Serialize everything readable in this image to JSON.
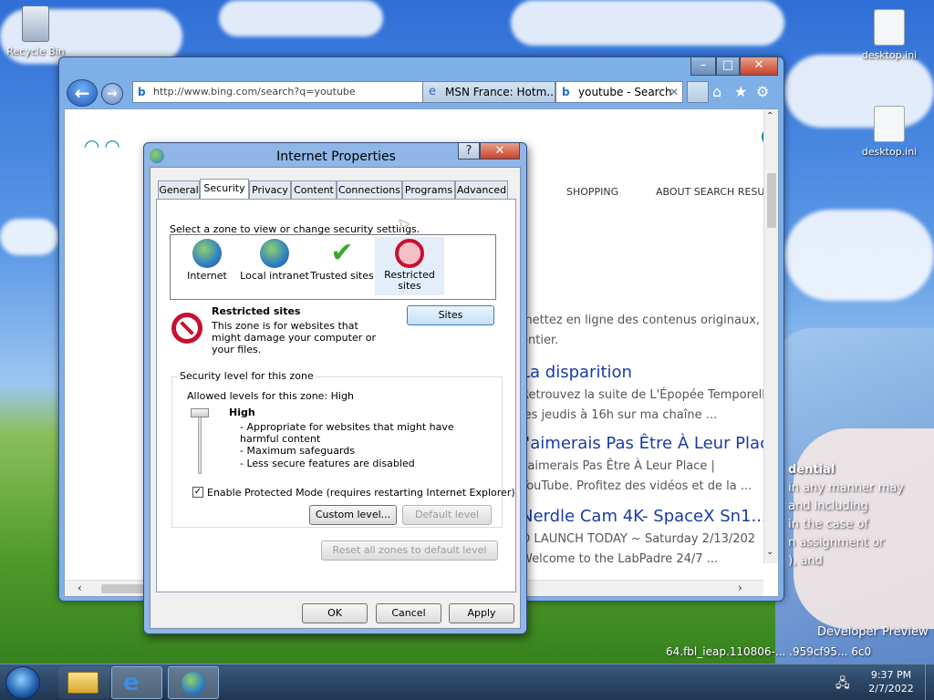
{
  "desktop": {
    "icons": [
      {
        "label": "Recycle Bin"
      },
      {
        "label": "desktop.ini"
      },
      {
        "label": "desktop.ini"
      }
    ],
    "watermark": {
      "line1": "dential",
      "line2": "in any manner may",
      "line3": "and including",
      "line4": "in the case of",
      "line5": "n assignment or",
      "line6": "), and",
      "line7": "Developer Preview",
      "line8": "64.fbl_ieap.110806-... .959cf95... 6c0"
    }
  },
  "ie": {
    "address": "http://www.bing.com/search?q=youtube",
    "tabs": [
      {
        "label": "MSN France: Hotm..."
      },
      {
        "label": "youtube - Search"
      }
    ],
    "nav_items": [
      {
        "label": "SHOPPING"
      },
      {
        "label": "ABOUT SEARCH RESU"
      }
    ],
    "results": [
      {
        "text": "mettez en ligne des contenus originaux,"
      },
      {
        "text": "entier."
      },
      {
        "title": "La disparition",
        "line1": "Retrouvez la suite de L'Épopée Temporelle",
        "line2": "les jeudis à 16h sur ma chaîne ..."
      },
      {
        "title": "J'aimerais Pas Être À Leur Place",
        "line1": "J'aimerais Pas Être À Leur Place |",
        "line2": "YouTube. Profitez des vidéos et de la ..."
      },
      {
        "title": "Nerdle Cam 4K- SpaceX Sn1...",
        "line1": "O LAUNCH TODAY ~ Saturday 2/13/202",
        "line2": "Welcome to the LabPadre 24/7 ..."
      }
    ]
  },
  "dialog": {
    "title": "Internet Properties",
    "tabs": [
      "General",
      "Security",
      "Privacy",
      "Content",
      "Connections",
      "Programs",
      "Advanced"
    ],
    "zone_prompt": "Select a zone to view or change security settings.",
    "zones": [
      {
        "label": "Internet",
        "icon": "globe-icon"
      },
      {
        "label": "Local intranet",
        "icon": "intranet-icon"
      },
      {
        "label": "Trusted sites",
        "icon": "checkmark-icon"
      },
      {
        "label": "Restricted sites",
        "icon": "restricted-icon"
      }
    ],
    "zone_heading": "Restricted sites",
    "zone_desc": "This zone is for websites that might damage your computer or your files.",
    "sites_button": "Sites",
    "security_group": "Security level for this zone",
    "allowed_levels": "Allowed levels for this zone: High",
    "level_name": "High",
    "level_points": [
      "- Appropriate for websites that might have harmful content",
      "- Maximum safeguards",
      "- Less secure features are disabled"
    ],
    "protected_mode": "Enable Protected Mode (requires restarting Internet Explorer)",
    "protected_mode_checked": true,
    "custom_level": "Custom level...",
    "default_level": "Default level",
    "reset_all": "Reset all zones to default level",
    "ok": "OK",
    "cancel": "Cancel",
    "apply": "Apply"
  },
  "taskbar": {
    "time": "9:37 PM",
    "date": "2/7/2022"
  },
  "colors": {
    "accent": "#1a3aa8",
    "restricted": "#c8102e"
  }
}
